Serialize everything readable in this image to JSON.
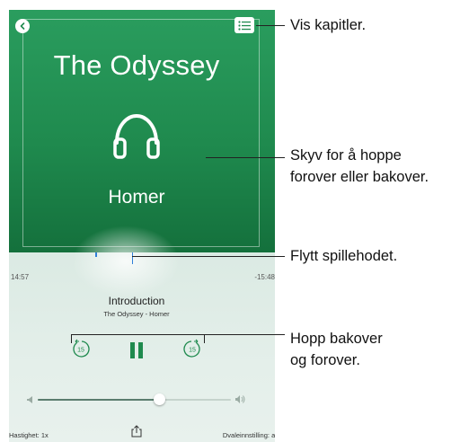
{
  "player": {
    "cover_title": "The Odyssey",
    "cover_author": "Homer",
    "time_elapsed": "14:57",
    "time_remaining": "-15:48",
    "chapter_title": "Introduction",
    "chapter_subtitle": "The Odyssey - Homer",
    "skip_back_seconds": "15",
    "skip_forward_seconds": "15",
    "speed_label": "Hastighet: 1x",
    "sleep_label": "Dvaleinnstilling: av",
    "volume_level": 0.63
  },
  "callouts": {
    "chapters": "Vis kapitler.",
    "swipe_line1": "Skyv for å hoppe",
    "swipe_line2": "forover eller bakover.",
    "playhead": "Flytt spillehodet.",
    "skip_line1": "Hopp bakover",
    "skip_line2": "og forover."
  },
  "colors": {
    "cover_green": "#1f8a4e",
    "accent_blue": "#2f7fd8",
    "panel_bg": "#e4efea"
  },
  "icons": [
    "back-icon",
    "chapters-list-icon",
    "headphones-icon",
    "skip-back-15-icon",
    "pause-icon",
    "skip-forward-15-icon",
    "volume-low-icon",
    "volume-high-icon",
    "share-icon"
  ]
}
